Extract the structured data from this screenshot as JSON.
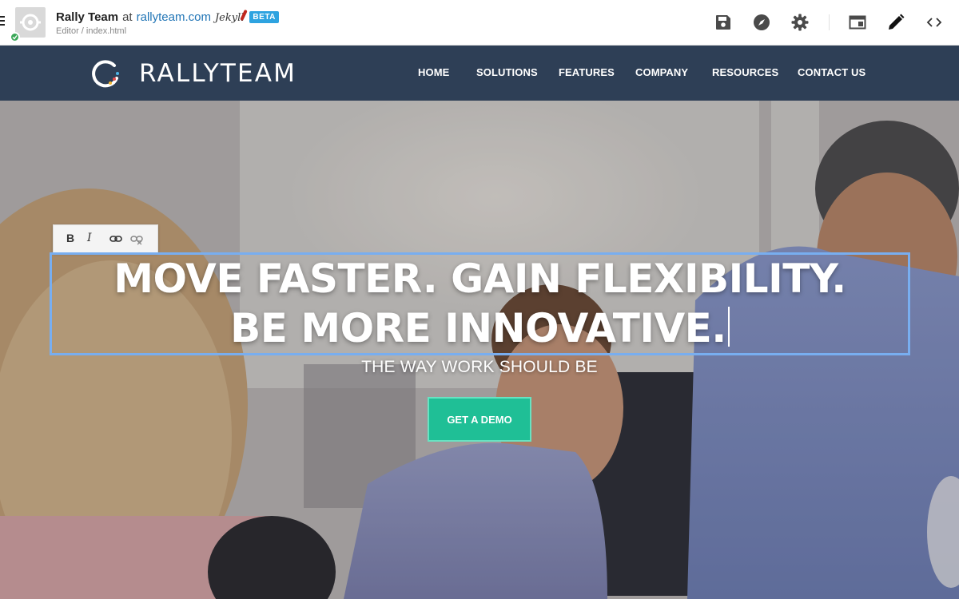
{
  "editor": {
    "site_name": "Rally Team",
    "at_text": "at",
    "domain": "rallyteam.com",
    "generator_logo": "Jekyll",
    "badge": "BETA",
    "breadcrumb": "Editor / index.html",
    "status": "published",
    "icons": [
      "menu-icon",
      "save-icon",
      "compass-icon",
      "gear-icon",
      "layout-icon",
      "pencil-icon",
      "code-icon"
    ]
  },
  "site": {
    "logo_text": "RALLYTEAM",
    "nav": [
      "HOME",
      "SOLUTIONS",
      "FEATURES",
      "COMPANY",
      "RESOURCES",
      "CONTACT US"
    ],
    "nav_bg": "#2e3f56"
  },
  "hero": {
    "headline_line1": "MOVE FASTER. GAIN FLEXIBILITY.",
    "headline_line2": "BE MORE INNOVATIVE.",
    "subheadline": "THE WAY WORK SHOULD BE",
    "cta_label": "GET A DEMO",
    "cta_color": "#1fbf96",
    "format_toolbar": [
      "B",
      "I",
      "link-icon",
      "unlink-icon"
    ],
    "selection_color": "#78aef0"
  }
}
